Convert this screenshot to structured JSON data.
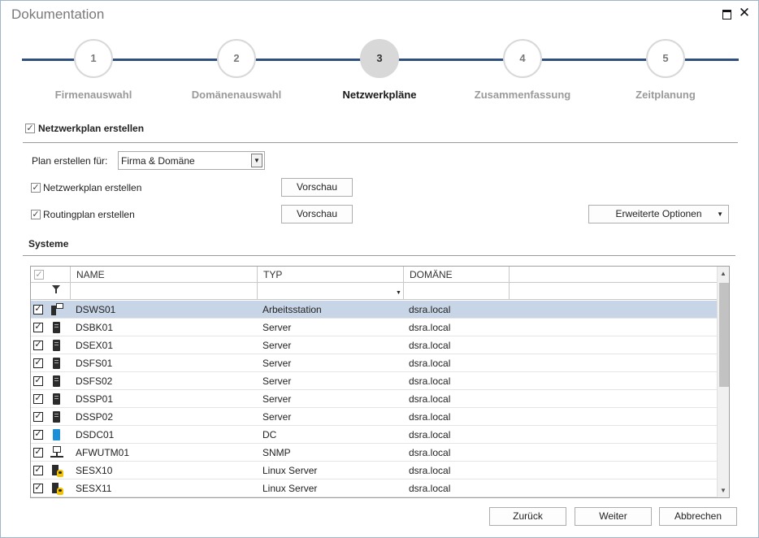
{
  "window": {
    "title": "Dokumentation"
  },
  "steps": [
    {
      "num": "1",
      "label": "Firmenauswahl"
    },
    {
      "num": "2",
      "label": "Domänenauswahl"
    },
    {
      "num": "3",
      "label": "Netzwerkpläne"
    },
    {
      "num": "4",
      "label": "Zusammenfassung"
    },
    {
      "num": "5",
      "label": "Zeitplanung"
    }
  ],
  "active_step": 3,
  "main_section": {
    "label": "Netzwerkplan erstellen",
    "checked": true
  },
  "plan_for": {
    "label": "Plan erstellen für:",
    "value": "Firma & Domäne"
  },
  "options": {
    "network_plan": {
      "label": "Netzwerkplan erstellen",
      "checked": true,
      "preview_label": "Vorschau"
    },
    "routing_plan": {
      "label": "Routingplan erstellen",
      "checked": true,
      "preview_label": "Vorschau"
    },
    "advanced_label": "Erweiterte Optionen"
  },
  "systems": {
    "section_label": "Systeme",
    "columns": [
      "NAME",
      "TYP",
      "DOMÄNE"
    ],
    "rows": [
      {
        "name": "DSWS01",
        "type": "Arbeitsstation",
        "domain": "dsra.local",
        "icon": "workstation-icon",
        "checked": true,
        "selected": true
      },
      {
        "name": "DSBK01",
        "type": "Server",
        "domain": "dsra.local",
        "icon": "server-icon",
        "checked": true
      },
      {
        "name": "DSEX01",
        "type": "Server",
        "domain": "dsra.local",
        "icon": "server-icon",
        "checked": true
      },
      {
        "name": "DSFS01",
        "type": "Server",
        "domain": "dsra.local",
        "icon": "server-icon",
        "checked": true
      },
      {
        "name": "DSFS02",
        "type": "Server",
        "domain": "dsra.local",
        "icon": "server-icon",
        "checked": true
      },
      {
        "name": "DSSP01",
        "type": "Server",
        "domain": "dsra.local",
        "icon": "server-icon",
        "checked": true
      },
      {
        "name": "DSSP02",
        "type": "Server",
        "domain": "dsra.local",
        "icon": "server-icon",
        "checked": true
      },
      {
        "name": "DSDC01",
        "type": "DC",
        "domain": "dsra.local",
        "icon": "domain-controller-icon",
        "checked": true
      },
      {
        "name": "AFWUTM01",
        "type": "SNMP",
        "domain": "dsra.local",
        "icon": "network-device-icon",
        "checked": true
      },
      {
        "name": "SESX10",
        "type": "Linux Server",
        "domain": "dsra.local",
        "icon": "linux-server-icon",
        "checked": true
      },
      {
        "name": "SESX11",
        "type": "Linux Server",
        "domain": "dsra.local",
        "icon": "linux-server-icon",
        "checked": true
      }
    ]
  },
  "footer": {
    "back_label": "Zurück",
    "next_label": "Weiter",
    "cancel_label": "Abbrechen"
  },
  "colors": {
    "accent_line": "#2f4f7f",
    "selected_row": "#c8d5e6",
    "dc_icon": "#1d8fd6"
  }
}
